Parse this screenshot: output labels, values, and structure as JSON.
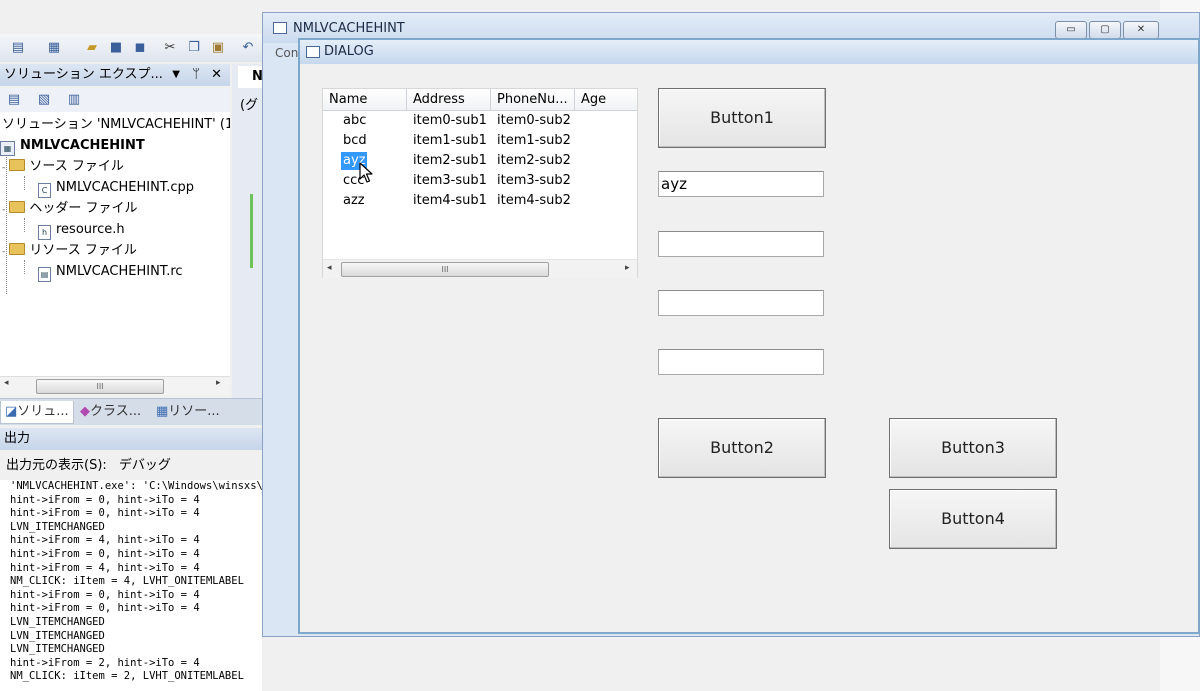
{
  "ide": {
    "solution_explorer": {
      "title": "ソリューション エクスプ...",
      "pin": "ᛘ",
      "close": "✕",
      "tree": [
        {
          "label": "ソリューション 'NMLVCACHEHINT' (1",
          "kind": "solution"
        },
        {
          "label": "NMLVCACHEHINT",
          "kind": "project"
        },
        {
          "label": "ソース ファイル",
          "kind": "folder"
        },
        {
          "label": "NMLVCACHEHINT.cpp",
          "kind": "file"
        },
        {
          "label": "ヘッダー ファイル",
          "kind": "folder"
        },
        {
          "label": "resource.h",
          "kind": "file"
        },
        {
          "label": "リソース ファイル",
          "kind": "folder"
        },
        {
          "label": "NMLVCACHEHINT.rc",
          "kind": "file"
        }
      ],
      "scroll_thumb": "III"
    },
    "bottom_tabs": [
      "ソリュ...",
      "クラス...",
      "リソー..."
    ],
    "editor_tab": "N",
    "editor_text": "(グ",
    "output": {
      "title": "出力",
      "source_label": "出力元の表示(S):",
      "source_value": "デバッグ",
      "lines": [
        "'NMLVCACHEHINT.exe': 'C:\\Windows\\winsxs\\",
        "hint->iFrom = 0, hint->iTo = 4",
        "hint->iFrom = 0, hint->iTo = 4",
        "LVN_ITEMCHANGED",
        "hint->iFrom = 4, hint->iTo = 4",
        "hint->iFrom = 0, hint->iTo = 4",
        "hint->iFrom = 4, hint->iTo = 4",
        "NM_CLICK: iItem = 4, LVHT_ONITEMLABEL",
        "hint->iFrom = 0, hint->iTo = 4",
        "hint->iFrom = 0, hint->iTo = 4",
        "LVN_ITEMCHANGED",
        "LVN_ITEMCHANGED",
        "LVN_ITEMCHANGED",
        "hint->iFrom = 2, hint->iTo = 4",
        "NM_CLICK: iItem = 2, LVHT_ONITEMLABEL"
      ]
    }
  },
  "outer_window": {
    "title": "NMLVCACHEHINT",
    "menu_fragment": "Con",
    "controls": {
      "minimize": "▭",
      "maximize": "▢",
      "close": "✕"
    }
  },
  "dialog": {
    "title": "DIALOG",
    "listview": {
      "columns": [
        "Name",
        "Address",
        "PhoneNu...",
        "Age"
      ],
      "rows": [
        [
          "abc",
          "item0-sub1",
          "item0-sub2"
        ],
        [
          "bcd",
          "item1-sub1",
          "item1-sub2"
        ],
        [
          "ayz",
          "item2-sub1",
          "item2-sub2"
        ],
        [
          "ccc",
          "item3-sub1",
          "item3-sub2"
        ],
        [
          "azz",
          "item4-sub1",
          "item4-sub2"
        ]
      ],
      "selected_row": 2,
      "scroll_thumb": "III"
    },
    "button1": "Button1",
    "edit1": "ayz",
    "edit2": "",
    "edit3": "",
    "edit4": "",
    "button2": "Button2",
    "button3": "Button3",
    "button4": "Button4"
  },
  "colors": {
    "selection": "#3399ff",
    "title_bar": "#cbdbef"
  }
}
